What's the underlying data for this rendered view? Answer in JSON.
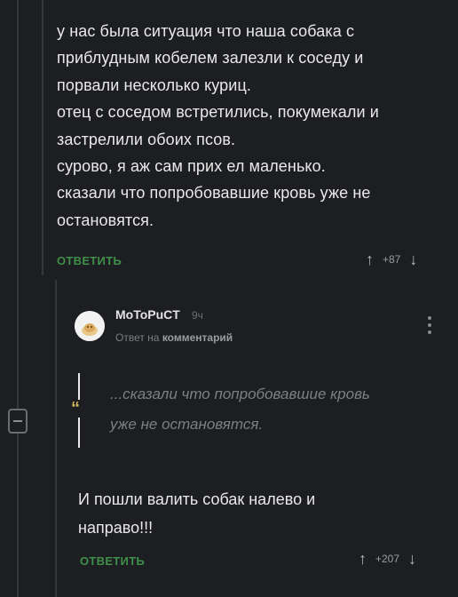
{
  "parent_comment": {
    "lines": [
      "у нас была ситуация что наша собака с",
      "приблудным кобелем залезли к соседу и",
      "порвали несколько куриц.",
      "отец с соседом встретились, покумекали и",
      "застрелили обоих псов.",
      "сурово, я аж сам прих  ел маленько.",
      "сказали что попробовавшие кровь уже не",
      "остановятся."
    ],
    "reply_label": "ОТВЕТИТЬ",
    "rating": "+87"
  },
  "reply_comment": {
    "author": "MoToPuCT",
    "time": "9ч",
    "reply_to_prefix": "Ответ на",
    "reply_to_target": "комментарий",
    "quote_lines": [
      "...сказали что попробовавшие кровь",
      "уже не остановятся."
    ],
    "quote_mark": "“",
    "text_lines": [
      "И пошли валить собак налево и",
      "направо!!!"
    ],
    "reply_label": "ОТВЕТИТЬ",
    "rating": "+207"
  },
  "icons": {
    "up_arrow": "↑",
    "down_arrow": "↓"
  },
  "colors": {
    "background": "#1d1e22",
    "accent_green": "#3f8f49",
    "quote_mark": "#d6b85a"
  }
}
